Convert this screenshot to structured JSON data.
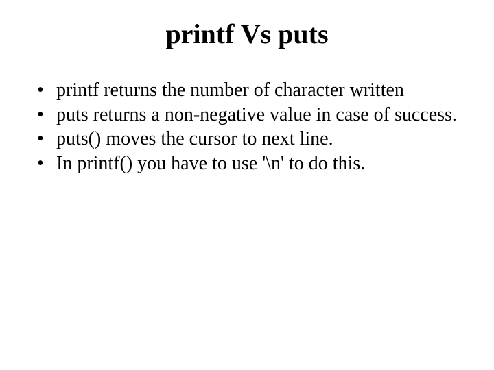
{
  "slide": {
    "title": "printf Vs puts",
    "bullets": [
      "printf returns the number of character written",
      "puts returns a non-negative value in case of success.",
      "puts() moves the cursor to next line.",
      "In printf() you have to use '\\n' to do this."
    ]
  }
}
